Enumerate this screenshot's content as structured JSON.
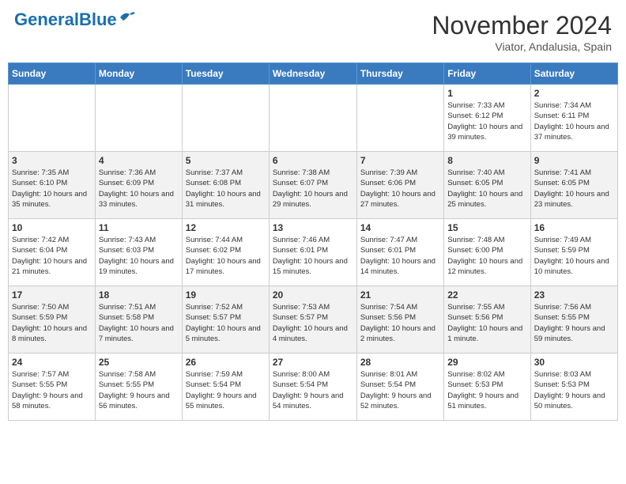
{
  "header": {
    "logo_general": "General",
    "logo_blue": "Blue",
    "month_title": "November 2024",
    "location": "Viator, Andalusia, Spain"
  },
  "calendar": {
    "days_of_week": [
      "Sunday",
      "Monday",
      "Tuesday",
      "Wednesday",
      "Thursday",
      "Friday",
      "Saturday"
    ],
    "weeks": [
      [
        {
          "day": "",
          "info": ""
        },
        {
          "day": "",
          "info": ""
        },
        {
          "day": "",
          "info": ""
        },
        {
          "day": "",
          "info": ""
        },
        {
          "day": "",
          "info": ""
        },
        {
          "day": "1",
          "info": "Sunrise: 7:33 AM\nSunset: 6:12 PM\nDaylight: 10 hours and 39 minutes."
        },
        {
          "day": "2",
          "info": "Sunrise: 7:34 AM\nSunset: 6:11 PM\nDaylight: 10 hours and 37 minutes."
        }
      ],
      [
        {
          "day": "3",
          "info": "Sunrise: 7:35 AM\nSunset: 6:10 PM\nDaylight: 10 hours and 35 minutes."
        },
        {
          "day": "4",
          "info": "Sunrise: 7:36 AM\nSunset: 6:09 PM\nDaylight: 10 hours and 33 minutes."
        },
        {
          "day": "5",
          "info": "Sunrise: 7:37 AM\nSunset: 6:08 PM\nDaylight: 10 hours and 31 minutes."
        },
        {
          "day": "6",
          "info": "Sunrise: 7:38 AM\nSunset: 6:07 PM\nDaylight: 10 hours and 29 minutes."
        },
        {
          "day": "7",
          "info": "Sunrise: 7:39 AM\nSunset: 6:06 PM\nDaylight: 10 hours and 27 minutes."
        },
        {
          "day": "8",
          "info": "Sunrise: 7:40 AM\nSunset: 6:05 PM\nDaylight: 10 hours and 25 minutes."
        },
        {
          "day": "9",
          "info": "Sunrise: 7:41 AM\nSunset: 6:05 PM\nDaylight: 10 hours and 23 minutes."
        }
      ],
      [
        {
          "day": "10",
          "info": "Sunrise: 7:42 AM\nSunset: 6:04 PM\nDaylight: 10 hours and 21 minutes."
        },
        {
          "day": "11",
          "info": "Sunrise: 7:43 AM\nSunset: 6:03 PM\nDaylight: 10 hours and 19 minutes."
        },
        {
          "day": "12",
          "info": "Sunrise: 7:44 AM\nSunset: 6:02 PM\nDaylight: 10 hours and 17 minutes."
        },
        {
          "day": "13",
          "info": "Sunrise: 7:46 AM\nSunset: 6:01 PM\nDaylight: 10 hours and 15 minutes."
        },
        {
          "day": "14",
          "info": "Sunrise: 7:47 AM\nSunset: 6:01 PM\nDaylight: 10 hours and 14 minutes."
        },
        {
          "day": "15",
          "info": "Sunrise: 7:48 AM\nSunset: 6:00 PM\nDaylight: 10 hours and 12 minutes."
        },
        {
          "day": "16",
          "info": "Sunrise: 7:49 AM\nSunset: 5:59 PM\nDaylight: 10 hours and 10 minutes."
        }
      ],
      [
        {
          "day": "17",
          "info": "Sunrise: 7:50 AM\nSunset: 5:59 PM\nDaylight: 10 hours and 8 minutes."
        },
        {
          "day": "18",
          "info": "Sunrise: 7:51 AM\nSunset: 5:58 PM\nDaylight: 10 hours and 7 minutes."
        },
        {
          "day": "19",
          "info": "Sunrise: 7:52 AM\nSunset: 5:57 PM\nDaylight: 10 hours and 5 minutes."
        },
        {
          "day": "20",
          "info": "Sunrise: 7:53 AM\nSunset: 5:57 PM\nDaylight: 10 hours and 4 minutes."
        },
        {
          "day": "21",
          "info": "Sunrise: 7:54 AM\nSunset: 5:56 PM\nDaylight: 10 hours and 2 minutes."
        },
        {
          "day": "22",
          "info": "Sunrise: 7:55 AM\nSunset: 5:56 PM\nDaylight: 10 hours and 1 minute."
        },
        {
          "day": "23",
          "info": "Sunrise: 7:56 AM\nSunset: 5:55 PM\nDaylight: 9 hours and 59 minutes."
        }
      ],
      [
        {
          "day": "24",
          "info": "Sunrise: 7:57 AM\nSunset: 5:55 PM\nDaylight: 9 hours and 58 minutes."
        },
        {
          "day": "25",
          "info": "Sunrise: 7:58 AM\nSunset: 5:55 PM\nDaylight: 9 hours and 56 minutes."
        },
        {
          "day": "26",
          "info": "Sunrise: 7:59 AM\nSunset: 5:54 PM\nDaylight: 9 hours and 55 minutes."
        },
        {
          "day": "27",
          "info": "Sunrise: 8:00 AM\nSunset: 5:54 PM\nDaylight: 9 hours and 54 minutes."
        },
        {
          "day": "28",
          "info": "Sunrise: 8:01 AM\nSunset: 5:54 PM\nDaylight: 9 hours and 52 minutes."
        },
        {
          "day": "29",
          "info": "Sunrise: 8:02 AM\nSunset: 5:53 PM\nDaylight: 9 hours and 51 minutes."
        },
        {
          "day": "30",
          "info": "Sunrise: 8:03 AM\nSunset: 5:53 PM\nDaylight: 9 hours and 50 minutes."
        }
      ]
    ]
  }
}
